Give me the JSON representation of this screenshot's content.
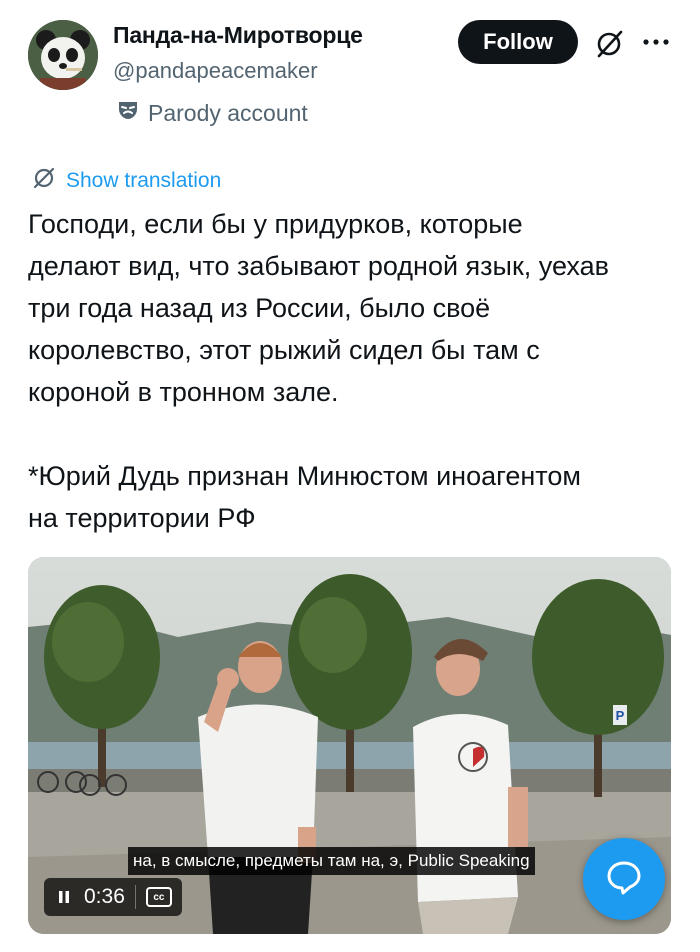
{
  "profile": {
    "name": "Панда-на-Миротворце",
    "handle": "@pandapeacemaker",
    "parody_label": "Parody account"
  },
  "actions": {
    "follow_label": "Follow",
    "grok_icon": "grok-icon",
    "more_icon": "more-dots-icon"
  },
  "translation": {
    "label": "Show translation"
  },
  "tweet": {
    "text": "Господи, если бы у придурков, которые\nделают вид, что забывают родной язык, уехав\nтри года назад из России, было своё\nкоролевство, этот рыжий сидел бы там с\nкороной в тронном зале.\n\n*Юрий Дудь признан Минюстом иноагентом\nна территории РФ"
  },
  "video": {
    "subtitle": "на, в смысле, предметы там на, э, Public Speaking",
    "time": "0:36",
    "cc_label": "cc",
    "sign_letter": "P"
  },
  "colors": {
    "accent": "#1d9bf0",
    "text": "#0f1419",
    "secondary": "#536471"
  }
}
